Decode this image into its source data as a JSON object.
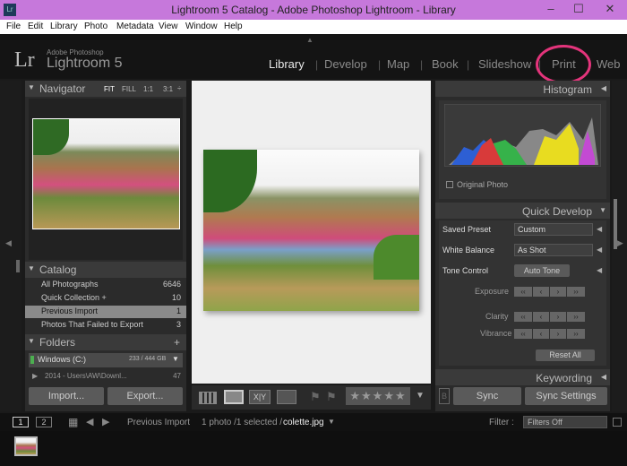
{
  "titlebar": {
    "title": "Lightroom 5 Catalog - Adobe Photoshop Lightroom - Library",
    "minimize": "–",
    "maximize": "☐",
    "close": "✕"
  },
  "menubar": {
    "items": [
      "File",
      "Edit",
      "Library",
      "Photo",
      "Metadata",
      "View",
      "Window",
      "Help"
    ]
  },
  "identity": {
    "logo": "Lr",
    "brand_small": "Adobe Photoshop",
    "brand": "Lightroom 5",
    "modules": [
      "Library",
      "Develop",
      "Map",
      "Book",
      "Slideshow",
      "Print",
      "Web"
    ],
    "active_module": "Library",
    "highlighted_module": "Print",
    "highlight_color": "#e3347b"
  },
  "navigator": {
    "title": "Navigator",
    "zoom": [
      "FIT",
      "FILL",
      "1:1",
      "3:1"
    ],
    "arrows": "÷"
  },
  "catalog": {
    "title": "Catalog",
    "items": [
      {
        "label": "All Photographs",
        "count": "6646"
      },
      {
        "label": "Quick Collection +",
        "count": "10"
      },
      {
        "label": "Previous Import",
        "count": "1"
      },
      {
        "label": "Photos That Failed to Export",
        "count": "3"
      }
    ]
  },
  "folders": {
    "title": "Folders",
    "add": "+",
    "volume": "Windows (C:)",
    "volume_info": "233 / 444 GB",
    "folder": "2014 - Users\\AW\\Downl...",
    "folder_count": "47"
  },
  "left_buttons": {
    "import": "Import...",
    "export": "Export..."
  },
  "toolbar": {
    "xy": "X|Y"
  },
  "histogram": {
    "title": "Histogram",
    "original_photo": "Original Photo"
  },
  "quick_develop": {
    "title": "Quick Develop",
    "saved_preset_label": "Saved Preset",
    "saved_preset_value": "Custom",
    "white_balance_label": "White Balance",
    "white_balance_value": "As Shot",
    "tone_control_label": "Tone Control",
    "auto_tone": "Auto Tone",
    "exposure": "Exposure",
    "clarity": "Clarity",
    "vibrance": "Vibrance",
    "reset_all": "Reset All"
  },
  "keywording": {
    "title": "Keywording"
  },
  "right_buttons": {
    "sync": "Sync",
    "sync_settings": "Sync Settings"
  },
  "filmbar": {
    "screen1": "1",
    "screen2": "2",
    "source": "Previous Import",
    "status": "1 photo /1 selected /",
    "filename": "colette.jpg",
    "filter_label": "Filter :",
    "filter_value": "Filters Off"
  }
}
